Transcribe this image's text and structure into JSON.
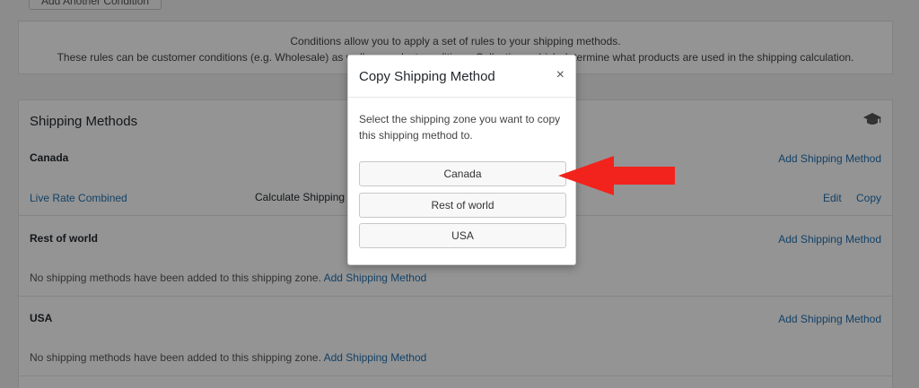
{
  "conditions": {
    "add_button": "Add Another Condition",
    "line1": "Conditions allow you to apply a set of rules to your shipping methods.",
    "line2": "These rules can be customer conditions (e.g. Wholesale) as well as product conditions. Collections which determine what products are used in the shipping calculation."
  },
  "methods": {
    "title": "Shipping Methods",
    "icon": "graduation-cap-icon",
    "zones": [
      {
        "name": "Canada",
        "add_label": "Add Shipping Method",
        "method_name": "Live Rate Combined",
        "method_desc": "Calculate Shipping Rates",
        "edit_label": "Edit",
        "copy_label": "Copy"
      },
      {
        "name": "Rest of world",
        "add_label": "Add Shipping Method",
        "note": "No shipping methods have been added to this shipping zone.",
        "note_link": "Add Shipping Method"
      },
      {
        "name": "USA",
        "add_label": "Add Shipping Method",
        "note": "No shipping methods have been added to this shipping zone.",
        "note_link": "Add Shipping Method"
      }
    ]
  },
  "modal": {
    "title": "Copy Shipping Method",
    "close_glyph": "×",
    "description": "Select the shipping zone you want to copy this shipping method to.",
    "options": [
      "Canada",
      "Rest of world",
      "USA"
    ]
  },
  "colors": {
    "link": "#2271b1",
    "arrow": "#f2231c",
    "overlay": "rgba(0,0,0,0.42)"
  }
}
